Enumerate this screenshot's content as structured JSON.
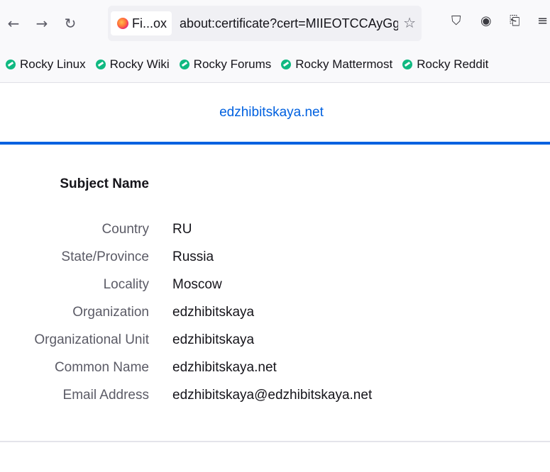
{
  "browser": {
    "tab_label": "Fi...ox",
    "url": "about:certificate?cert=MIIEOTCCAyGg",
    "nav_icons": {
      "back": "arrow-left-icon",
      "forward": "arrow-right-icon",
      "reload": "reload-icon",
      "bookmark_star": "star-icon",
      "pocket": "pocket-icon",
      "account": "account-icon",
      "extensions": "extensions-icon",
      "menu": "hamburger-menu-icon"
    }
  },
  "bookmarks": [
    {
      "label": "Rocky Linux"
    },
    {
      "label": "Rocky Wiki"
    },
    {
      "label": "Rocky Forums"
    },
    {
      "label": "Rocky Mattermost"
    },
    {
      "label": "Rocky Reddit"
    }
  ],
  "certificate": {
    "tab": "edzhibitskaya.net",
    "section_title": "Subject Name",
    "fields": [
      {
        "label": "Country",
        "value": "RU"
      },
      {
        "label": "State/Province",
        "value": "Russia"
      },
      {
        "label": "Locality",
        "value": "Moscow"
      },
      {
        "label": "Organization",
        "value": "edzhibitskaya"
      },
      {
        "label": "Organizational Unit",
        "value": "edzhibitskaya"
      },
      {
        "label": "Common Name",
        "value": "edzhibitskaya.net"
      },
      {
        "label": "Email Address",
        "value": "edzhibitskaya@edzhibitskaya.net"
      }
    ]
  },
  "colors": {
    "accent": "#0061e0",
    "bookmark_icon": "#10b981"
  }
}
